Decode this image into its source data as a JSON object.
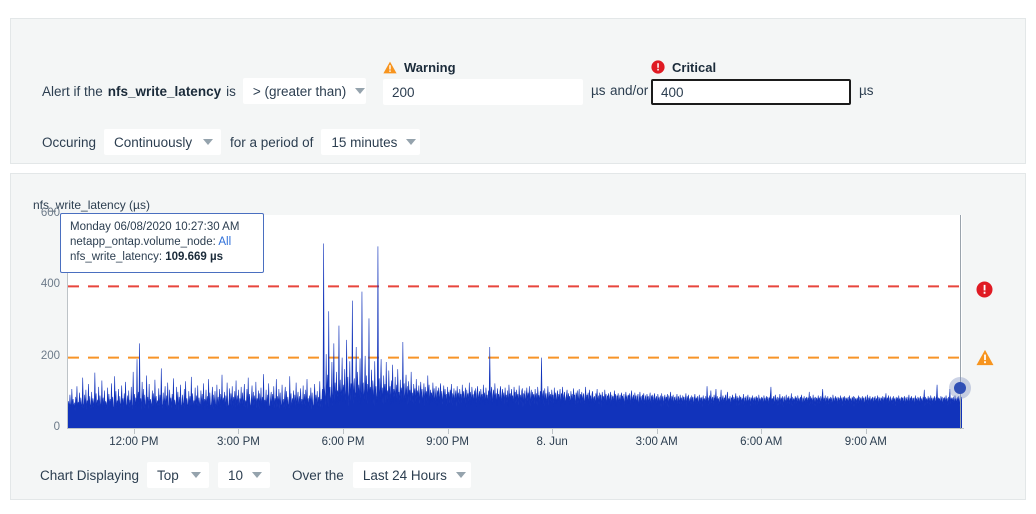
{
  "alert_form": {
    "prefix": "Alert if the",
    "metric": "nfs_write_latency",
    "is_label": "is",
    "operator": "> (greater than)",
    "occuring_label": "Occuring",
    "occuring_value": "Continuously",
    "period_label": "for a period of",
    "period_value": "15 minutes",
    "warning": {
      "label": "Warning",
      "icon": "warning-triangle-icon",
      "value": "200",
      "unit": "µs",
      "color": "#f7941e"
    },
    "and_or": "and/or",
    "critical": {
      "label": "Critical",
      "icon": "critical-circle-icon",
      "value": "400",
      "unit": "µs",
      "color": "#e01b24"
    }
  },
  "chart": {
    "title": "nfs_write_latency (µs)",
    "tooltip": {
      "timestamp": "Monday 06/08/2020 10:27:30 AM",
      "node_label": "netapp_ontap.volume_node:",
      "node_value": "All",
      "metric_label": "nfs_write_latency:",
      "metric_value": "109.669 µs"
    },
    "controls": {
      "displaying_label": "Chart Displaying",
      "top_value": "Top",
      "count_value": "10",
      "over_label": "Over the",
      "range_value": "Last 24 Hours"
    }
  },
  "chart_data": {
    "type": "area",
    "title": "nfs_write_latency (µs)",
    "xlabel": "",
    "ylabel": "nfs_write_latency (µs)",
    "ylim": [
      0,
      600
    ],
    "yticks": [
      0,
      200,
      400,
      600
    ],
    "xticks": [
      "12:00 PM",
      "3:00 PM",
      "6:00 PM",
      "9:00 PM",
      "8. Jun",
      "3:00 AM",
      "6:00 AM",
      "9:00 AM"
    ],
    "grid": false,
    "legend": "none",
    "series_name": "nfs_write_latency",
    "series_color": "#1133bb",
    "thresholds": [
      {
        "name": "Critical",
        "value": 400,
        "color": "#e8453c",
        "style": "dashed"
      },
      {
        "name": "Warning",
        "value": 200,
        "color": "#f79428",
        "style": "dashed"
      }
    ],
    "highlight_point": {
      "x_label": "Monday 06/08/2020 10:27:30 AM",
      "y": 109.669,
      "unit": "µs"
    },
    "baseline_range": [
      45,
      95
    ],
    "peak_value": 512,
    "values": [
      62,
      78,
      55,
      96,
      70,
      58,
      112,
      66,
      84,
      60,
      74,
      52,
      90,
      68,
      120,
      58,
      76,
      64,
      102,
      56,
      88,
      70,
      60,
      144,
      72,
      58,
      96,
      64,
      110,
      54,
      80,
      66,
      126,
      60,
      92,
      70,
      58,
      104,
      62,
      86,
      74,
      56,
      158,
      68,
      100,
      58,
      82,
      64,
      118,
      52,
      94,
      70,
      60,
      136,
      66,
      88,
      56,
      108,
      62,
      78,
      72,
      54,
      116,
      60,
      98,
      66,
      84,
      58,
      128,
      70,
      90,
      62,
      56,
      148,
      64,
      106,
      58,
      80,
      68,
      112,
      54,
      92,
      60,
      74,
      122,
      66,
      86,
      56,
      100,
      62,
      132,
      70,
      58,
      94,
      64,
      108,
      52,
      82,
      60,
      118,
      68,
      56,
      160,
      72,
      98,
      60,
      88,
      66,
      196,
      58,
      104,
      70,
      240,
      62,
      86,
      54,
      132,
      64,
      112,
      58,
      96,
      70,
      60,
      150,
      66,
      90,
      56,
      126,
      62,
      84,
      72,
      58,
      108,
      64,
      100,
      54,
      138,
      68,
      92,
      60,
      80,
      66,
      114,
      56,
      96,
      62,
      170,
      70,
      58,
      102,
      64,
      86,
      120,
      54,
      94,
      60,
      130,
      68,
      56,
      110,
      72,
      88,
      58,
      98,
      64,
      142,
      60,
      82,
      70,
      56,
      118,
      66,
      104,
      52,
      90,
      62,
      124,
      68,
      58,
      96,
      74,
      60,
      112,
      56,
      134,
      64,
      86,
      70,
      58,
      106,
      62,
      92,
      54,
      146,
      66,
      100,
      60,
      80,
      68,
      116,
      58,
      94,
      64,
      122,
      56,
      88,
      72,
      60,
      108,
      66,
      98,
      52,
      128,
      60,
      84,
      70,
      110,
      58,
      92,
      64,
      140,
      56,
      102,
      68,
      60,
      86,
      118,
      54,
      96,
      62,
      106,
      70,
      58,
      124,
      64,
      90,
      56,
      112,
      60,
      98,
      66,
      152,
      58,
      88,
      70,
      104,
      54,
      94,
      62,
      130,
      68,
      60,
      82,
      114,
      56,
      100,
      64,
      120,
      58,
      90,
      72,
      106,
      60,
      136,
      56,
      94,
      66,
      110,
      52,
      86,
      70,
      118,
      58,
      102,
      64,
      92,
      126,
      60,
      80,
      68,
      112,
      56,
      144,
      62,
      98,
      70,
      58,
      88,
      122,
      54,
      104,
      66,
      94,
      60,
      132,
      58,
      86,
      72,
      108,
      56,
      100,
      64,
      116,
      60,
      90,
      68,
      154,
      58,
      82,
      70,
      110,
      54,
      96,
      62,
      128,
      66,
      60,
      88,
      104,
      56,
      98,
      72,
      120,
      58,
      86,
      64,
      140,
      60,
      92,
      68,
      112,
      56,
      102,
      70,
      58,
      124,
      66,
      84,
      60,
      94,
      118,
      54,
      106,
      62,
      90,
      70,
      58,
      148,
      64,
      100,
      56,
      86,
      72,
      108,
      60,
      96,
      66,
      130,
      58,
      88,
      104,
      54,
      92,
      70,
      114,
      60,
      84,
      68,
      122,
      56,
      98,
      64,
      110,
      58,
      140,
      72,
      86,
      60,
      94,
      66,
      116,
      54,
      102,
      70,
      58,
      88,
      126,
      62,
      96,
      68,
      106,
      56,
      90,
      74,
      134,
      60,
      84,
      66,
      112,
      58,
      520,
      120,
      98,
      66,
      210,
      74,
      152,
      60,
      330,
      86,
      118,
      72,
      96,
      188,
      64,
      108,
      240,
      80,
      130,
      70,
      160,
      92,
      108,
      74,
      290,
      66,
      138,
      88,
      112,
      200,
      76,
      124,
      96,
      168,
      70,
      110,
      250,
      84,
      146,
      64,
      106,
      190,
      78,
      128,
      96,
      360,
      70,
      118,
      142,
      88,
      104,
      230,
      76,
      160,
      92,
      124,
      72,
      198,
      108,
      66,
      385,
      96,
      130,
      76,
      112,
      205,
      88,
      150,
      70,
      126,
      96,
      310,
      78,
      118,
      94,
      166,
      72,
      136,
      108,
      64,
      190,
      88,
      120,
      72,
      104,
      512,
      96,
      142,
      76,
      128,
      196,
      84,
      116,
      70,
      150,
      98,
      126,
      72,
      188,
      88,
      108,
      76,
      164,
      94,
      120,
      68,
      136,
      98,
      180,
      74,
      112,
      90,
      146,
      70,
      124,
      84,
      168,
      96,
      104,
      72,
      138,
      92,
      116,
      70,
      244,
      86,
      128,
      74,
      106,
      152,
      90,
      120,
      68,
      134,
      96,
      110,
      78,
      160,
      88,
      102,
      72,
      126,
      94,
      114,
      66,
      140,
      84,
      108,
      90,
      122,
      70,
      104,
      132,
      86,
      112,
      74,
      96,
      128,
      64,
      118,
      90,
      106,
      72,
      150,
      84,
      124,
      68,
      110,
      94,
      102,
      76,
      130,
      86,
      114,
      70,
      98,
      120,
      64,
      108,
      92,
      116,
      74,
      100,
      128,
      82,
      106,
      68,
      94,
      122,
      76,
      112,
      88,
      98,
      64,
      118,
      86,
      104,
      72,
      110,
      94,
      126,
      66,
      100,
      84,
      114,
      72,
      96,
      108,
      62,
      120,
      88,
      102,
      70,
      112,
      92,
      98,
      66,
      124,
      84,
      106,
      74,
      96,
      116,
      62,
      110,
      88,
      100,
      70,
      130,
      82,
      104,
      68,
      118,
      94,
      96,
      72,
      108,
      86,
      114,
      64,
      100,
      120,
      76,
      94,
      106,
      68,
      112,
      88,
      98,
      74,
      124,
      84,
      102,
      66,
      116,
      90,
      96,
      70,
      108,
      86,
      230,
      78,
      104,
      118,
      66,
      96,
      110,
      72,
      128,
      84,
      100,
      64,
      114,
      90,
      98,
      76,
      106,
      120,
      68,
      94,
      112,
      82,
      102,
      70,
      116,
      88,
      96,
      74,
      108,
      64,
      124,
      90,
      100,
      78,
      112,
      86,
      94,
      68,
      118,
      96,
      104,
      72,
      110,
      84,
      98,
      66,
      122,
      88,
      96,
      74,
      106,
      114,
      62,
      100,
      90,
      108,
      70,
      94,
      116,
      78,
      102,
      86,
      120,
      64,
      96,
      110,
      74,
      104,
      88,
      98,
      70,
      112,
      84,
      100,
      66,
      118,
      92,
      94,
      76,
      106,
      88,
      200,
      70,
      96,
      108,
      64,
      114,
      82,
      100,
      72,
      92,
      120,
      66,
      104,
      86,
      98,
      74,
      110,
      90,
      96,
      64,
      116,
      84,
      102,
      70,
      94,
      108,
      76,
      98,
      88,
      112,
      62,
      100,
      90,
      118,
      72,
      94,
      104,
      68,
      86,
      96,
      110,
      74,
      100,
      88,
      92,
      66,
      106,
      84,
      98,
      70,
      114,
      90,
      96,
      60,
      102,
      86,
      108,
      72,
      94,
      112,
      64,
      98,
      88,
      104,
      76,
      92,
      100,
      66,
      86,
      118,
      74,
      96,
      90,
      102,
      62,
      110,
      84,
      94,
      70,
      98,
      106,
      72,
      88,
      92,
      64,
      100,
      86,
      112,
      74,
      94,
      68,
      102,
      90,
      96,
      60,
      104,
      86,
      92,
      72,
      110,
      82,
      98,
      66,
      94,
      88,
      100,
      74,
      90,
      104,
      62,
      96,
      86,
      92,
      70,
      108,
      84,
      98,
      64,
      94,
      88,
      100,
      72,
      86,
      96,
      68,
      102,
      90,
      92,
      74,
      98,
      62,
      88,
      104,
      80,
      94,
      70,
      96,
      86,
      100,
      64,
      92,
      108,
      74,
      88,
      96,
      66,
      102,
      84,
      94,
      70,
      90,
      98,
      62,
      86,
      104,
      78,
      92,
      66,
      96,
      88,
      100,
      70,
      84,
      94,
      64,
      98,
      86,
      92,
      72,
      88,
      102,
      60,
      94,
      82,
      96,
      68,
      90,
      100,
      74,
      86,
      92,
      64,
      98,
      84,
      88,
      70,
      94,
      62,
      100,
      80,
      92,
      66,
      86,
      96,
      72,
      90,
      84,
      98,
      60,
      94,
      78,
      88,
      104,
      68,
      92,
      82,
      96,
      64,
      88,
      90,
      74,
      84,
      98,
      62,
      92,
      86,
      70,
      96,
      80,
      88,
      66,
      94,
      84,
      90,
      72,
      86,
      100,
      62,
      92,
      78,
      96,
      68,
      84,
      88,
      70,
      94,
      82,
      90,
      64,
      86,
      98,
      74,
      88,
      80,
      92,
      66,
      84,
      96,
      70,
      88,
      82,
      90,
      62,
      94,
      78,
      86,
      72,
      92,
      68,
      120,
      84,
      88,
      66,
      94,
      80,
      108,
      72,
      86,
      90,
      64,
      96,
      82,
      88,
      112,
      70,
      92,
      78,
      86,
      64,
      90,
      84,
      110,
      68,
      86,
      94,
      72,
      88,
      82,
      96,
      66,
      90,
      104,
      74,
      86,
      80,
      92,
      62,
      88,
      84,
      96,
      70,
      90,
      78,
      86,
      100,
      64,
      92,
      82,
      88,
      66,
      94,
      84,
      90,
      72,
      86,
      80,
      98,
      62,
      88,
      84,
      92,
      68,
      86,
      96,
      74,
      82,
      90,
      64,
      88,
      78,
      94,
      70,
      86,
      82,
      90,
      66,
      92,
      84,
      88,
      62,
      96,
      80,
      86,
      72,
      90,
      78,
      88,
      64,
      94,
      82,
      86,
      70,
      92,
      76,
      90,
      66,
      88,
      84,
      94,
      118,
      72,
      86,
      80,
      92,
      64,
      88,
      96,
      74,
      84,
      90,
      66,
      86,
      82,
      98,
      70,
      88,
      78,
      92,
      62,
      86,
      90,
      74,
      82,
      96,
      68,
      88,
      84,
      92,
      70,
      86,
      80,
      100,
      64,
      90,
      78,
      86,
      72,
      92,
      84,
      88,
      66,
      94,
      80,
      86,
      70,
      90,
      82,
      96,
      62,
      88,
      76,
      92,
      68,
      86,
      84,
      90,
      72,
      88,
      78,
      104,
      66,
      92,
      82,
      86,
      70,
      96,
      78,
      88,
      64,
      90,
      84,
      86,
      72,
      94,
      80,
      88,
      66,
      92,
      76,
      90,
      112,
      70,
      86,
      82,
      94,
      64,
      88,
      78,
      92,
      68,
      86,
      80,
      90,
      74,
      88,
      62,
      96,
      82,
      86,
      70,
      92,
      78,
      88,
      66,
      90,
      84,
      86,
      72,
      94,
      76,
      88,
      64,
      90,
      80,
      92,
      68,
      86,
      82,
      88,
      74,
      90,
      66,
      94,
      78,
      86,
      70,
      88,
      84,
      92,
      62,
      90,
      80,
      86,
      72,
      88,
      76,
      94,
      66,
      90,
      82,
      86,
      70,
      92,
      78,
      88,
      64,
      86,
      90,
      74,
      84,
      96,
      68,
      88,
      80,
      92,
      70,
      86,
      78,
      90,
      66,
      88,
      84,
      92,
      72,
      86,
      80,
      94,
      64,
      90,
      82,
      86,
      70,
      88,
      76,
      92,
      68,
      90,
      84,
      86,
      100,
      72,
      88,
      80,
      94,
      66,
      86,
      90,
      74,
      82,
      88,
      70,
      92,
      78,
      86,
      64,
      90,
      80,
      88,
      72,
      94,
      76,
      86,
      68,
      90,
      82,
      88,
      70,
      86,
      92,
      64,
      88,
      78,
      90,
      72,
      84,
      96,
      66,
      88,
      80,
      92,
      70,
      86,
      84,
      88,
      62,
      94,
      78,
      86,
      72,
      90,
      80,
      88,
      66,
      92,
      76,
      86,
      70,
      88,
      84,
      110,
      64,
      90,
      78,
      86,
      72,
      92,
      80,
      88,
      66,
      94,
      82,
      86,
      70,
      88,
      76,
      92,
      68,
      86,
      90,
      124,
      74,
      88,
      80,
      86,
      70,
      92,
      78,
      90,
      64,
      86,
      84,
      88,
      72,
      94,
      80,
      86,
      66,
      90,
      78,
      112,
      70,
      88,
      82,
      86,
      74,
      90,
      66,
      94,
      78,
      86,
      70,
      88,
      84,
      92,
      62,
      86,
      80,
      90,
      72
    ]
  }
}
